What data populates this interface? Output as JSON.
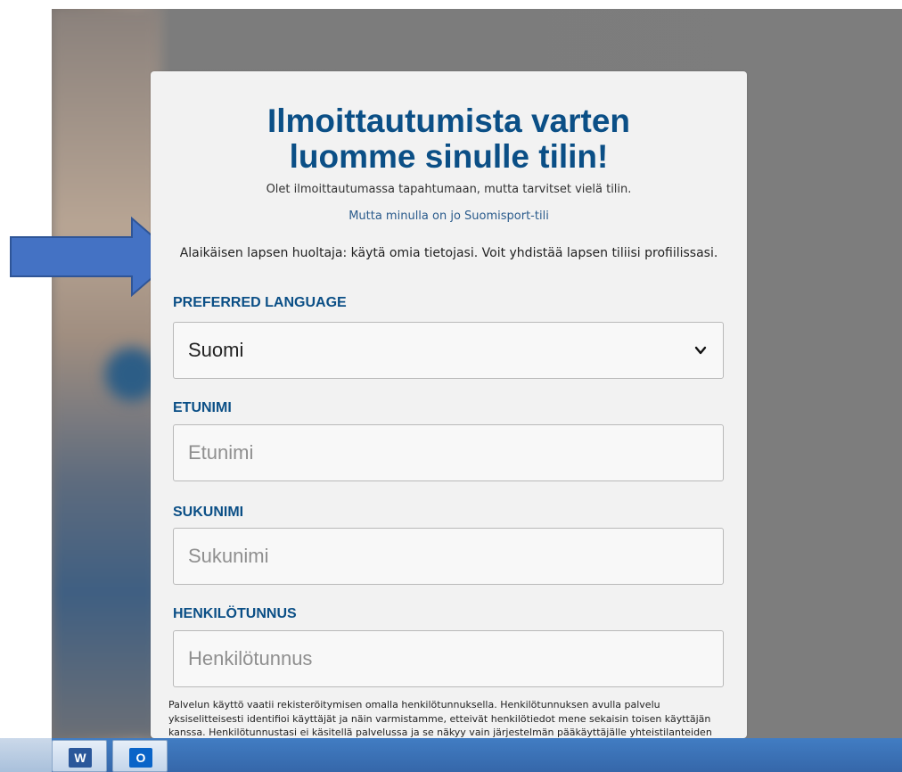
{
  "signup": {
    "title": "Ilmoittautumista varten\nluomme sinulle tilin!",
    "subtitle": "Olet ilmoittautumassa tapahtumaan, mutta tarvitset vielä tilin.",
    "existing_account_link": "Mutta minulla on jo Suomisport-tili",
    "guardian_note": "Alaikäisen lapsen huoltaja: käytä omia tietojasi. Voit yhdistää lapsen tiliisi profiilissasi.",
    "language": {
      "label": "PREFERRED LANGUAGE",
      "selected": "Suomi"
    },
    "first_name": {
      "label": "ETUNIMI",
      "placeholder": "Etunimi"
    },
    "last_name": {
      "label": "SUKUNIMI",
      "placeholder": "Sukunimi"
    },
    "ssn": {
      "label": "HENKILÖTUNNUS",
      "placeholder": "Henkilötunnus"
    },
    "ssn_help": "Palvelun käyttö vaatii rekisteröitymisen omalla henkilötunnuksella. Henkilötunnuksen avulla palvelu yksiselitteisesti identifioi käyttäjät ja näin varmistamme, etteivät henkilötiedot mene sekaisin toisen käyttäjän kanssa. Henkilötunnustasi ei käsitellä palvelussa ja se näkyy vain järjestelmän pääkäyttäjälle yhteistilanteiden korjaamiste"
  },
  "taskbar": {
    "apps": [
      {
        "icon": "word-icon",
        "letter": "W"
      },
      {
        "icon": "outlook-icon",
        "letter": "O"
      }
    ]
  },
  "colors": {
    "brand_blue": "#0b4f86",
    "link_blue": "#2a5b8c",
    "arrow_fill": "#4472c4",
    "arrow_stroke": "#2f5597"
  }
}
